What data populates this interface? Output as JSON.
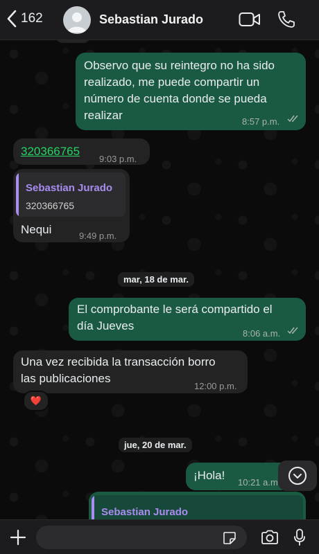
{
  "header": {
    "back_count": "162",
    "contact_name": "Sebastian Jurado"
  },
  "messages": [
    {
      "lines": [
        "Observo que su reintegro no ha sido",
        "realizado, me puede compartir un",
        "número de cuenta donde se pueda",
        "realizar"
      ],
      "time": "8:57 p.m."
    },
    {
      "text": "320366765",
      "time": "9:03 p.m."
    },
    {
      "quote_name": "Sebastian Jurado",
      "quote_text": "320366765",
      "text": "Nequi",
      "time": "9:49 p.m."
    },
    {
      "lines": [
        "El comprobante le será compartido el",
        "día Jueves"
      ],
      "time": "8:06 a.m."
    },
    {
      "lines": [
        "Una vez recibida la transacción borro",
        "las publicaciones"
      ],
      "time": "12:00 p.m.",
      "reaction": "❤️"
    },
    {
      "text": "¡Hola!",
      "time": "10:21 a.m."
    },
    {
      "quote_name": "Sebastian Jurado"
    }
  ],
  "dates": [
    "mar, 18 de mar.",
    "jue, 20 de mar."
  ],
  "composer": {
    "placeholder": ""
  },
  "icons": [
    "chevron-left-icon",
    "video-call-icon",
    "phone-icon",
    "plus-icon",
    "sticker-icon",
    "camera-icon",
    "microphone-icon",
    "chevron-down-icon",
    "double-check-icon"
  ],
  "colors": {
    "outgoing": "#1a5a43",
    "incoming": "#232323",
    "link": "#25d366",
    "quote_name": "#a98cf0"
  }
}
